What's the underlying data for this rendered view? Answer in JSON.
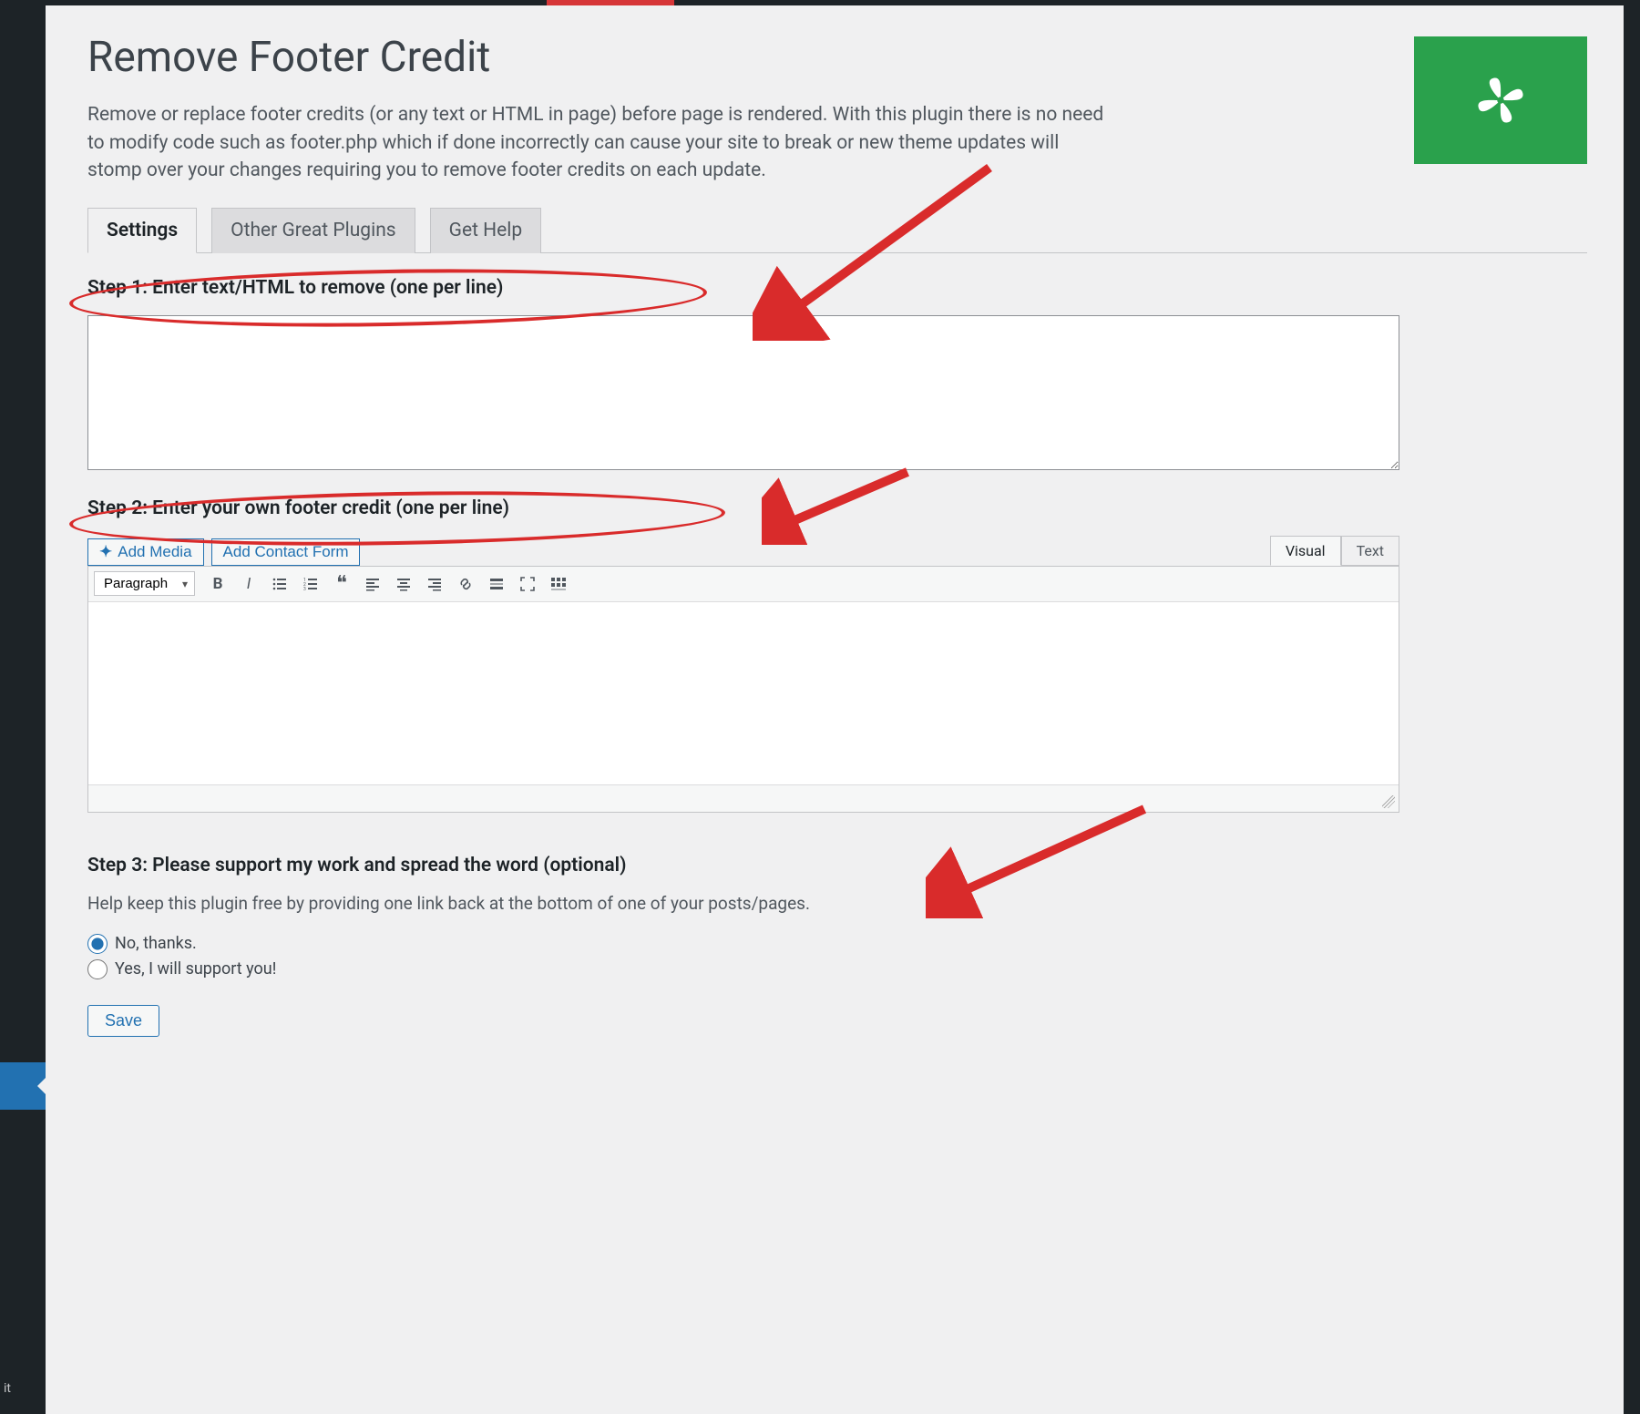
{
  "page": {
    "title": "Remove Footer Credit",
    "description": "Remove or replace footer credits (or any text or HTML in page) before page is rendered. With this plugin there is no need to modify code such as footer.php which if done incorrectly can cause your site to break or new theme updates will stomp over your changes requiring you to remove footer credits on each update."
  },
  "sidebar": {
    "active_label": "it"
  },
  "tabs": [
    {
      "label": "Settings",
      "active": true
    },
    {
      "label": "Other Great Plugins",
      "active": false
    },
    {
      "label": "Get Help",
      "active": false
    }
  ],
  "steps": {
    "one": {
      "heading": "Step 1: Enter text/HTML to remove (one per line)",
      "value": ""
    },
    "two": {
      "heading": "Step 2: Enter your own footer credit (one per line)"
    },
    "three": {
      "heading": "Step 3: Please support my work and spread the word (optional)",
      "help": "Help keep this plugin free by providing one link back at the bottom of one of your posts/pages.",
      "options": {
        "no": "No, thanks.",
        "yes": "Yes, I will support you!"
      },
      "selected": "no"
    }
  },
  "editor": {
    "add_media": "Add Media",
    "add_contact": "Add Contact Form",
    "tab_visual": "Visual",
    "tab_text": "Text",
    "format_select": "Paragraph",
    "content": ""
  },
  "buttons": {
    "save": "Save"
  },
  "colors": {
    "annotation": "#d92b2b",
    "brand_green": "#2aa14c",
    "wp_blue": "#2271b1"
  }
}
